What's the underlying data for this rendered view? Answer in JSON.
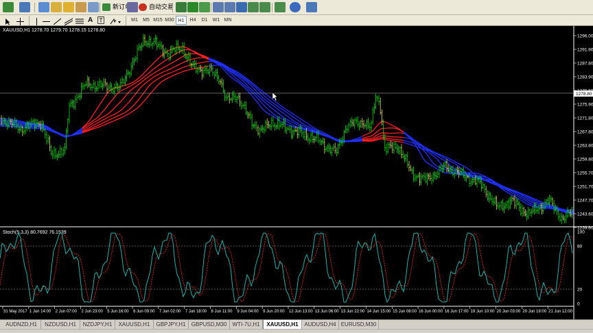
{
  "toolbar": {
    "new_order_label": "新订单",
    "auto_trading_label": "自动交易",
    "timeframes": [
      "M1",
      "M5",
      "M15",
      "M30",
      "H1",
      "H4",
      "D1",
      "W1",
      "MN"
    ],
    "active_timeframe": "H1"
  },
  "chart": {
    "header": "XAUUSD,H1  1278.70 1279.70 1278.15 1278.80",
    "current_price": "1278.80",
    "price_ticks": [
      "1296.00",
      "1291.90",
      "1287.80",
      "1283.90",
      "1279.50",
      "1275.90",
      "1271.80",
      "1267.80",
      "1263.80",
      "1259.80",
      "1255.70",
      "1251.70",
      "1247.70",
      "1243.60",
      "1239.60"
    ],
    "indicator_header": "Stoch(5,3,3) 80.7692 76.1539",
    "indicator_ticks": [
      "100",
      "80",
      "20",
      "0"
    ],
    "time_labels": [
      "31 May 2017",
      "1 Jun 14:00",
      "2 Jun 07:00",
      "2 Jun 23:00",
      "5 Jun 16:00",
      "6 Jun 09:00",
      "7 Jun 02:00",
      "7 Jun 18:00",
      "8 Jun 11:00",
      "9 Jun 04:00",
      "9 Jun 20:00",
      "12 Jun 13:00",
      "13 Jun 06:00",
      "13 Jun 22:00",
      "14 Jun 15:00",
      "15 Jun 08:00",
      "16 Jun 00:00",
      "16 Jun 17:00",
      "19 Jun 10:00",
      "20 Jun 03:00",
      "20 Jun 19:00",
      "21 Jun 12:00"
    ],
    "colors": {
      "bull": "#00ff00",
      "bear": "#ff0000",
      "ribbon_red": "#ff2020",
      "ribbon_blue": "#2030ff",
      "stoch_main": "#20b2aa",
      "stoch_signal": "#ff3030"
    }
  },
  "tabs": [
    "AUDNZD,H1",
    "NZDUSD,H1",
    "NZDJPY,H1",
    "XAUUSD,H1",
    "GBPJPY,H1",
    "GBPUSD,M30",
    "WTI-7U,H1",
    "XAUUSD,H1",
    "AUDUSD,H4",
    "EURUSD,M30"
  ],
  "active_tab": 7
}
